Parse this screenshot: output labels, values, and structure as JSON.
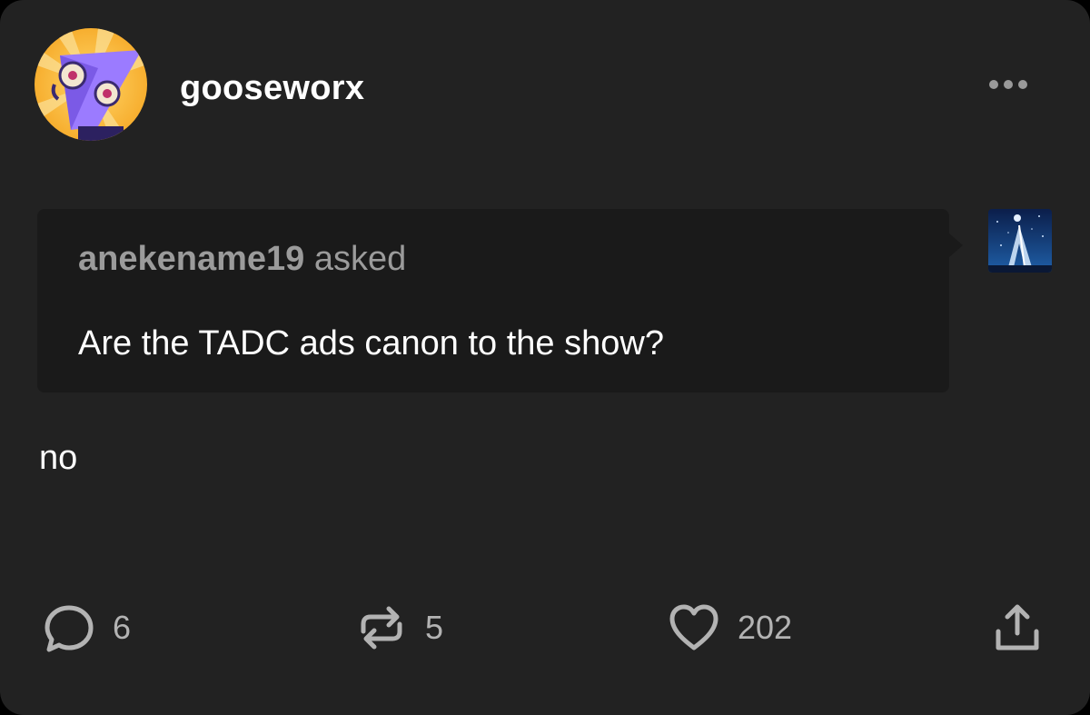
{
  "post": {
    "username": "gooseworx",
    "ask": {
      "asker": "anekename19",
      "verb": "asked",
      "question": "Are the TADC ads canon to the show?"
    },
    "answer": "no"
  },
  "icons": {
    "more": "more-options-icon",
    "reply": "speech-bubble-icon",
    "reblog": "reblog-arrows-icon",
    "like": "heart-icon",
    "share": "share-upload-icon"
  },
  "actions": {
    "replies": "6",
    "reblogs": "5",
    "likes": "202"
  },
  "colors": {
    "card_bg": "#222222",
    "ask_bg": "#1a1a1a",
    "text": "#ffffff",
    "muted": "#9b9b9b",
    "icon": "#b3b3b3"
  }
}
